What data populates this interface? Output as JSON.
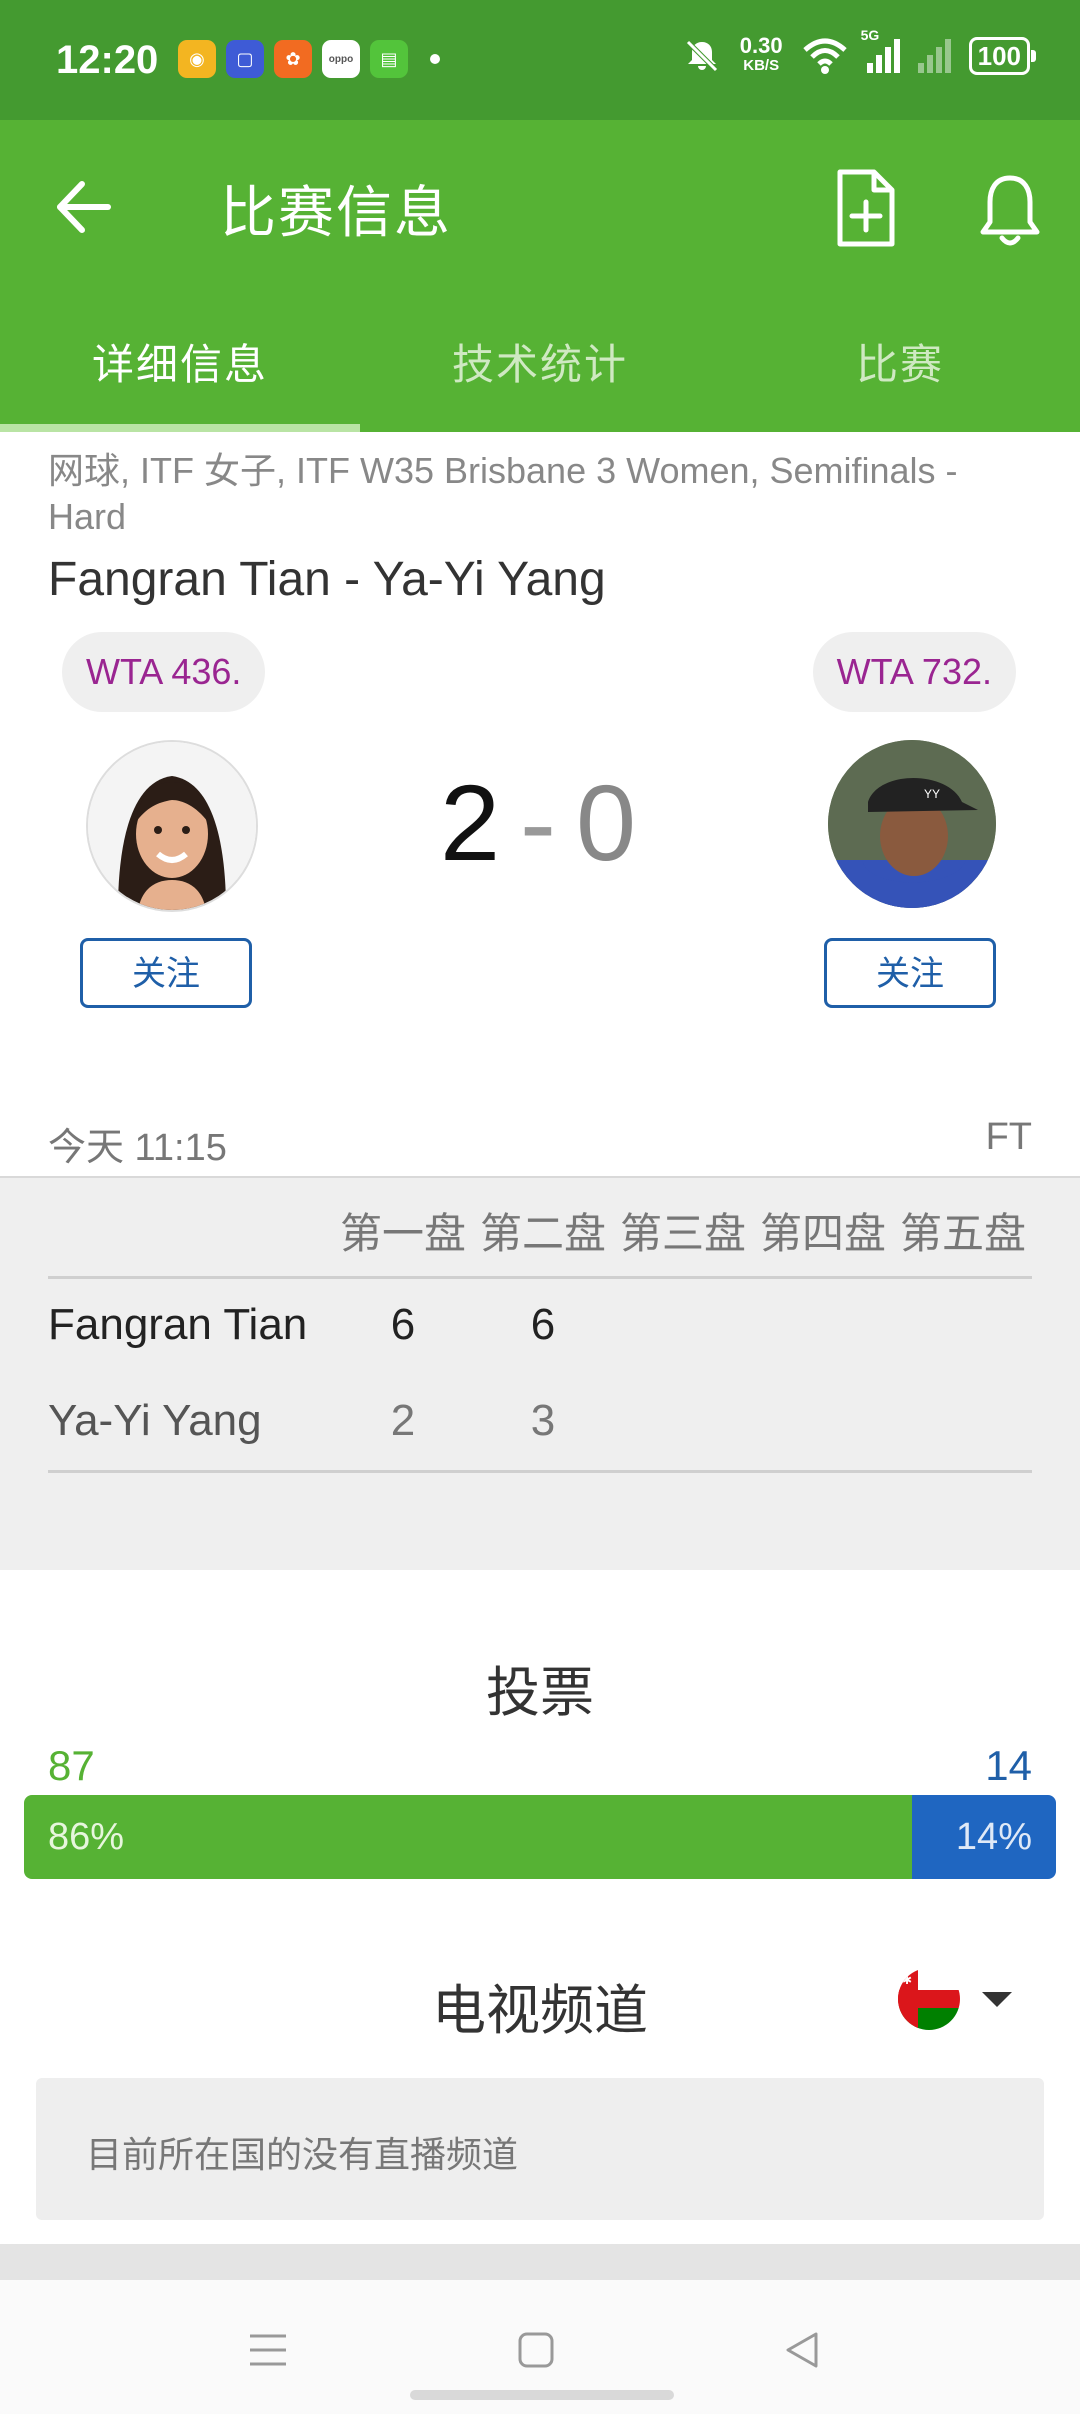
{
  "status_bar": {
    "time": "12:20",
    "net_speed": "0.30",
    "net_unit": "KB/S",
    "signal_label": "5G",
    "battery": "100"
  },
  "app_bar": {
    "title": "比赛信息"
  },
  "tabs": [
    {
      "label": "详细信息",
      "active": true
    },
    {
      "label": "技术统计",
      "active": false
    },
    {
      "label": "比赛",
      "active": false
    }
  ],
  "match": {
    "league": "网球, ITF 女子, ITF W35 Brisbane 3 Women, Semifinals - Hard",
    "title": "Fangran Tian - Ya-Yi Yang",
    "home_rank": "WTA 436.",
    "away_rank": "WTA 732.",
    "home_score": "2",
    "separator": "-",
    "away_score": "0",
    "follow_label": "关注",
    "time": "今天 11:15",
    "status": "FT"
  },
  "sets": {
    "headers": [
      "第一盘",
      "第二盘",
      "第三盘",
      "第四盘",
      "第五盘"
    ],
    "rows": [
      {
        "player": "Fangran Tian",
        "scores": [
          "6",
          "6"
        ]
      },
      {
        "player": "Ya-Yi Yang",
        "scores": [
          "2",
          "3"
        ]
      }
    ]
  },
  "votes": {
    "title": "投票",
    "home_count": "87",
    "away_count": "14",
    "home_pct_label": "86%",
    "away_pct_label": "14%",
    "home_pct": 86
  },
  "tv": {
    "title": "电视频道",
    "message": "目前所在国的没有直播频道"
  },
  "colors": {
    "brand_green": "#56b234",
    "status_green": "#449a30",
    "away_blue": "#1f66c1",
    "rank_purple": "#9a2591"
  }
}
